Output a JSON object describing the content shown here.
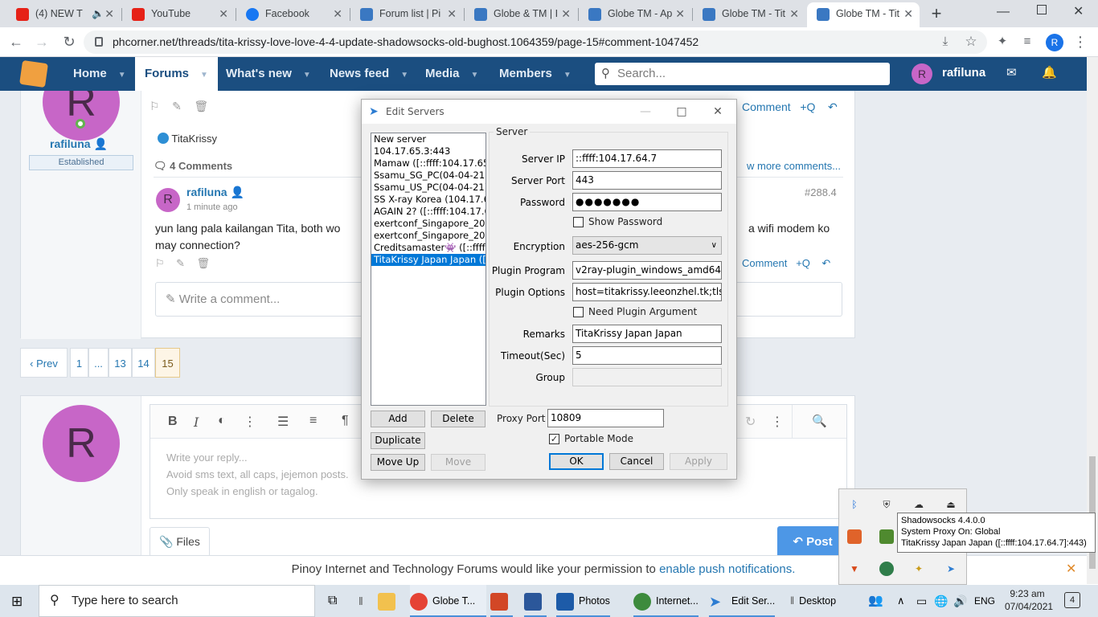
{
  "browser": {
    "tabs": [
      {
        "label": "(4) NEW T",
        "color": "#e62117"
      },
      {
        "label": "YouTube",
        "color": "#e62117"
      },
      {
        "label": "Facebook",
        "color": "#1877f2"
      },
      {
        "label": "Forum list | Pi",
        "color": "#3a78c2"
      },
      {
        "label": "Globe & TM | I",
        "color": "#3a78c2"
      },
      {
        "label": "Globe TM - Ap",
        "color": "#3a78c2"
      },
      {
        "label": "Globe TM - Tit",
        "color": "#3a78c2"
      },
      {
        "label": "Globe TM - Tit",
        "color": "#3a78c2",
        "active": true
      }
    ],
    "url": "phcorner.net/threads/tita-krissy-love-love-4-4-update-shadowsocks-old-bughost.1064359/page-15#comment-1047452",
    "profile_letter": "R"
  },
  "site": {
    "nav": [
      "Home",
      "Forums",
      "What's new",
      "News feed",
      "Media",
      "Members"
    ],
    "search_placeholder": "Search...",
    "username": "rafiluna",
    "avatar_letter": "R"
  },
  "post": {
    "author": "rafiluna",
    "author_badge": "Established",
    "avatar_letter": "R",
    "reaction_user": "TitaKrissy",
    "comments_count": "4 Comments",
    "view_more": "w more comments...",
    "comment_label": "Comment",
    "quote_label": "+Q",
    "comment": {
      "author": "rafiluna",
      "time": "1 minute ago",
      "number": "#288.4",
      "text_line1": "yun lang pala kailangan Tita, both wo",
      "text_line1_right": "a wifi modem ko",
      "text_line2": "may connection?"
    },
    "write_comment": "Write a comment..."
  },
  "pagination": [
    "‹ Prev",
    "1",
    "...",
    "13",
    "14",
    "15"
  ],
  "reply": {
    "avatar_letter": "R",
    "placeholder_lines": [
      "Write your reply...",
      "Avoid sms text, all caps, jejemon posts.",
      "Only speak in english or tagalog."
    ],
    "files_label": "Files",
    "post_label": "Post"
  },
  "notice": {
    "text": "Pinoy Internet and Technology Forums would like your permission to",
    "link": "enable push notifications."
  },
  "dialog": {
    "title": "Edit Servers",
    "servers": [
      "New server",
      "104.17.65.3:443",
      "Mamaw ([::ffff:104.17.65.6]",
      "Ssamu_SG_PC(04-04-21)? (",
      "Ssamu_US_PC(04-04-21)? (",
      "SS X-ray Korea (104.17.65.1",
      "AGAIN 2? ([::ffff:104.17.64.",
      "exertconf_Singapore_2021",
      "exertconf_Singapore_2021",
      "Creditsamaster👾 ([::ffff:10",
      "TitaKrissy Japan Japan ([::ff"
    ],
    "selected_index": 10,
    "group_label": "Server",
    "fields": {
      "server_ip_label": "Server IP",
      "server_ip": "::ffff:104.17.64.7",
      "server_port_label": "Server Port",
      "server_port": "443",
      "password_label": "Password",
      "password": "●●●●●●●",
      "show_password": "Show Password",
      "encryption_label": "Encryption",
      "encryption": "aes-256-gcm",
      "plugin_program_label": "Plugin Program",
      "plugin_program": "v2ray-plugin_windows_amd64",
      "plugin_options_label": "Plugin Options",
      "plugin_options": "host=titakrissy.leeonzhel.tk;tls",
      "need_plugin_arg": "Need Plugin Argument",
      "remarks_label": "Remarks",
      "remarks": "TitaKrissy Japan Japan",
      "timeout_label": "Timeout(Sec)",
      "timeout": "5",
      "group_field_label": "Group",
      "group_value": ""
    },
    "proxy_port_label": "Proxy Port",
    "proxy_port": "10809",
    "portable_mode": "Portable Mode",
    "portable_checked": true,
    "buttons": {
      "add": "Add",
      "delete": "Delete",
      "duplicate": "Duplicate",
      "move_up": "Move Up",
      "move": "Move",
      "ok": "OK",
      "cancel": "Cancel",
      "apply": "Apply"
    }
  },
  "tooltip": [
    "Shadowsocks 4.4.0.0",
    "System Proxy On: Global",
    "TitaKrissy Japan Japan ([::ffff:104.17.64.7]:443)"
  ],
  "taskbar": {
    "search_placeholder": "Type here to search",
    "apps": [
      "Globe T...",
      "Photos",
      "Internet...",
      "Edit Ser...",
      "Desktop"
    ],
    "lang": "ENG",
    "time": "9:23 am",
    "date": "07/04/2021",
    "notif_count": "4"
  }
}
